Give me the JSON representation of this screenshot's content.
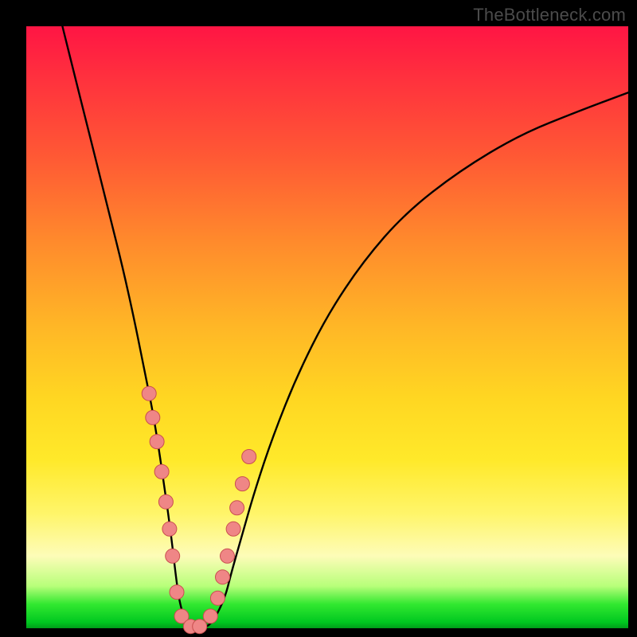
{
  "watermark": "TheBottleneck.com",
  "colors": {
    "frame": "#000000",
    "curve": "#000000",
    "marker_fill": "#ef8686",
    "marker_stroke": "#c94f4f",
    "gradient_stops": [
      "#ff1544",
      "#ff2f3e",
      "#ff5a34",
      "#ff8b2c",
      "#ffb726",
      "#ffd722",
      "#ffe92a",
      "#fff56a",
      "#fdfcb8",
      "#b8ff7a",
      "#32e830",
      "#00c820",
      "#009e1a"
    ]
  },
  "chart_data": {
    "type": "line",
    "title": "",
    "xlabel": "",
    "ylabel": "",
    "xlim": [
      0,
      100
    ],
    "ylim": [
      0,
      100
    ],
    "grid": false,
    "legend": false,
    "series": [
      {
        "name": "curve",
        "x": [
          6,
          8,
          10,
          12,
          14,
          16,
          18,
          20,
          21,
          22,
          23,
          24,
          24.8,
          25.5,
          26.5,
          28,
          29.5,
          31,
          33,
          34,
          36,
          38,
          41,
          45,
          50,
          56,
          63,
          72,
          82,
          92,
          100
        ],
        "y": [
          100,
          92,
          84,
          76,
          68,
          60,
          51,
          41,
          36,
          30,
          23,
          16,
          9,
          4,
          1,
          0,
          0,
          1,
          5,
          9,
          16,
          23,
          32,
          42,
          52,
          61,
          69,
          76,
          82,
          86,
          89
        ]
      }
    ],
    "markers": {
      "name": "highlight-dots",
      "x": [
        20.4,
        21.0,
        21.7,
        22.5,
        23.2,
        23.8,
        24.3,
        25.0,
        25.8,
        27.3,
        28.8,
        30.6,
        31.8,
        32.6,
        33.4,
        34.4,
        35.0,
        35.9,
        37.0
      ],
      "y": [
        39.0,
        35.0,
        31.0,
        26.0,
        21.0,
        16.5,
        12.0,
        6.0,
        2.0,
        0.3,
        0.3,
        2.0,
        5.0,
        8.5,
        12.0,
        16.5,
        20.0,
        24.0,
        28.5
      ]
    }
  }
}
